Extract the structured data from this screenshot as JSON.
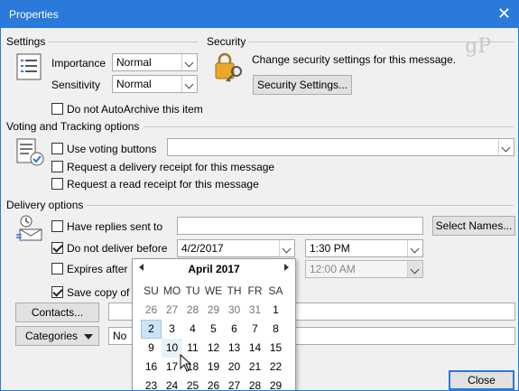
{
  "window": {
    "title": "Properties"
  },
  "watermark": "gP",
  "settings": {
    "heading": "Settings",
    "importance_label": "Importance",
    "importance_value": "Normal",
    "sensitivity_label": "Sensitivity",
    "sensitivity_value": "Normal",
    "autoarchive_label": "Do not AutoArchive this item"
  },
  "security": {
    "heading": "Security",
    "description": "Change security settings for this message.",
    "button_label": "Security Settings..."
  },
  "voting": {
    "heading": "Voting and Tracking options",
    "use_voting_label": "Use voting buttons",
    "voting_value": "",
    "delivery_receipt_label": "Request a delivery receipt for this message",
    "read_receipt_label": "Request a read receipt for this message"
  },
  "delivery": {
    "heading": "Delivery options",
    "replies_label": "Have replies sent to",
    "replies_value": "",
    "select_names_label": "Select Names...",
    "deliver_before_label": "Do not deliver before",
    "deliver_date": "4/2/2017",
    "deliver_time": "1:30 PM",
    "expires_label": "Expires after",
    "expires_time": "12:00 AM",
    "save_copy_label": "Save copy of se",
    "contacts_label": "Contacts...",
    "contacts_value": "",
    "categories_label": "Categories",
    "categories_value": "No"
  },
  "calendar": {
    "title": "April 2017",
    "weekdays": [
      "SU",
      "MO",
      "TU",
      "WE",
      "TH",
      "FR",
      "SA"
    ],
    "weeks": [
      [
        "26",
        "27",
        "28",
        "29",
        "30",
        "31",
        "1"
      ],
      [
        "2",
        "3",
        "4",
        "5",
        "6",
        "7",
        "8"
      ],
      [
        "9",
        "10",
        "11",
        "12",
        "13",
        "14",
        "15"
      ],
      [
        "16",
        "17",
        "18",
        "19",
        "20",
        "21",
        "22"
      ],
      [
        "23",
        "24",
        "25",
        "26",
        "27",
        "28",
        "29"
      ]
    ],
    "selected_day": "2",
    "today_day": "10"
  },
  "footer": {
    "close_label": "Close"
  }
}
